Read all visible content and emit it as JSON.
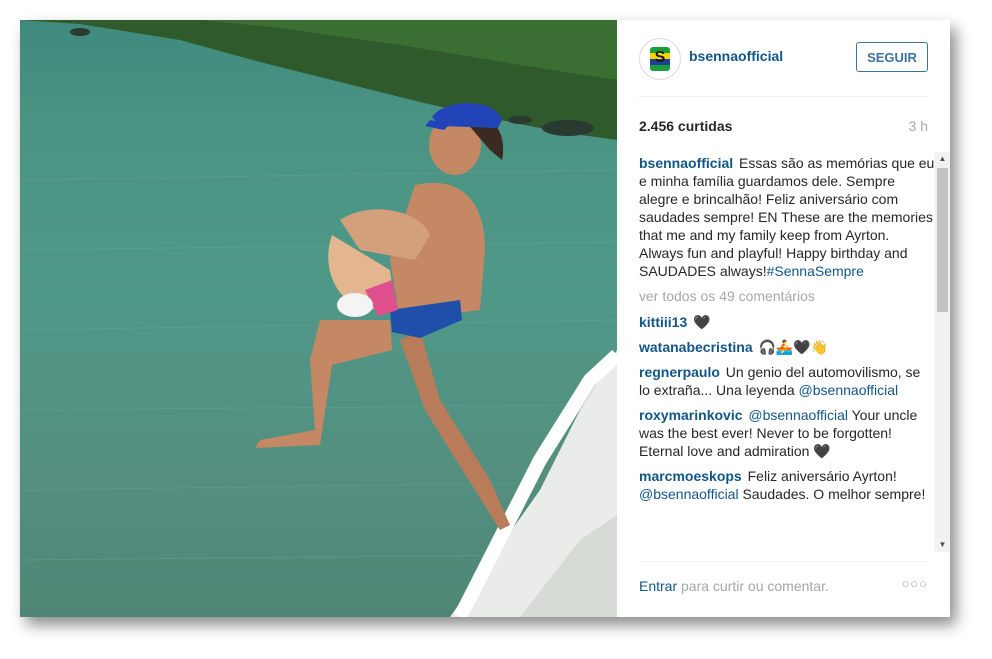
{
  "post": {
    "username": "bsennaofficial",
    "follow_label": "SEGUIR",
    "likes": "2.456 curtidas",
    "time_ago": "3 h",
    "caption": {
      "user": "bsennaofficial",
      "text": "Essas são as memórias que eu e minha família guardamos dele. Sempre alegre e brincalhão! Feliz aniversário com saudades sempre! EN These are the memories that me and my family keep from Ayrton. Always fun and playful! Happy birthday and SAUDADES always!",
      "hashtag": "#SennaSempre"
    },
    "view_all": "ver todos os 49 comentários",
    "comments": [
      {
        "user": "kittiii13",
        "mention": "",
        "text": "🖤"
      },
      {
        "user": "watanabecristina",
        "mention": "",
        "text": "🎧🚣🖤👋"
      },
      {
        "user": "regnerpaulo",
        "mention": "",
        "text": "Un genio del automovilismo, se lo extraña... Una leyenda",
        "after_mention": "@bsennaofficial"
      },
      {
        "user": "roxymarinkovic",
        "mention": "@bsennaofficial",
        "text": "Your uncle was the best ever! Never to be forgotten! Eternal love and admiration 🖤"
      },
      {
        "user": "marcmoeskops",
        "mention": "",
        "text": "Feliz aniversário Ayrton!",
        "after_mention": "@bsennaofficial",
        "after_text": "Saudades. O melhor sempre!"
      }
    ],
    "footer": {
      "login_link": "Entrar",
      "login_text": "para curtir ou comentar.",
      "more": "○○○"
    }
  },
  "icons": {
    "avatar": "brazil-flag-helmet-logo",
    "more": "ellipsis-icon",
    "scroll_up": "▲",
    "scroll_down": "▼"
  },
  "colors": {
    "link_blue": "#125688",
    "follow_blue": "#3f729b",
    "muted_grey": "#a5a7aa",
    "water_green": "#4f9888"
  }
}
